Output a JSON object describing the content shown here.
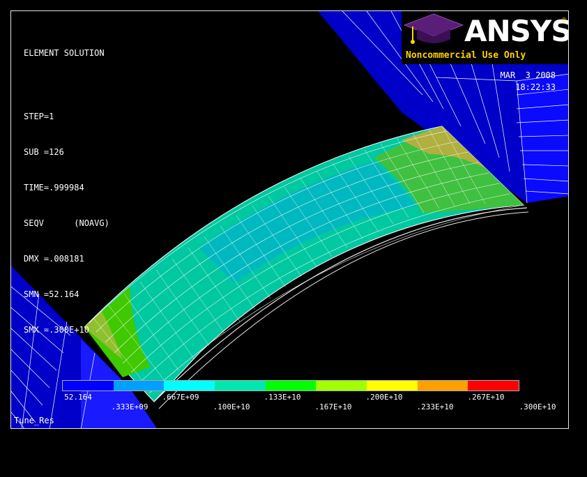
{
  "window": {
    "info_title": "ELEMENT SOLUTION",
    "info_lines": [
      "STEP=1",
      "SUB =126",
      "TIME=.999984",
      "SEQV      (NOAVG)",
      "DMX =.008181",
      "SMN =52.164",
      "SMX =.300E+10"
    ],
    "date": "MAR  3 2008",
    "time": "18:22:33",
    "jobname": "Tune_Res"
  },
  "logo": {
    "name": "ANSYS",
    "registered": "®",
    "subtitle": "Noncommercial Use Only",
    "icon": "graduation-cap-icon"
  },
  "legend": {
    "colors": [
      "#0000ff",
      "#00a0ff",
      "#00ffff",
      "#00e8b0",
      "#00ff00",
      "#a0ff00",
      "#ffff00",
      "#ffa000",
      "#ff0000"
    ],
    "labels_row1": [
      "52.164",
      ".667E+09",
      ".133E+10",
      ".200E+10",
      ".267E+10"
    ],
    "labels_row2": [
      ".333E+09",
      ".100E+10",
      ".167E+10",
      ".233E+10",
      ".300E+10"
    ]
  },
  "colors": {
    "background": "#000000",
    "block": "#0000c8",
    "text": "#ffffff",
    "logo_accent": "#ffd400"
  }
}
